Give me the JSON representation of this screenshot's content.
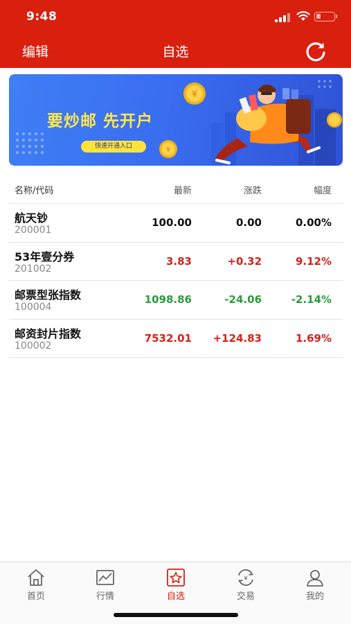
{
  "status_bar": {
    "time": "9:48",
    "battery_percent": 25
  },
  "nav": {
    "left_label": "编辑",
    "title": "自选",
    "right_icon": "refresh-icon"
  },
  "banner": {
    "headline": "要炒邮 先开户",
    "button_label": "快速开通入口"
  },
  "table": {
    "headers": {
      "name": "名称/代码",
      "latest": "最新",
      "change": "涨跌",
      "pct": "幅度"
    },
    "rows": [
      {
        "name": "航天钞",
        "code": "200001",
        "latest": "100.00",
        "change": "0.00",
        "pct": "0.00%"
      },
      {
        "name": "53年壹分券",
        "code": "201002",
        "latest": "3.83",
        "change": "+0.32",
        "pct": "9.12%"
      },
      {
        "name": "邮票型张指数",
        "code": "100004",
        "latest": "1098.86",
        "change": "-24.06",
        "pct": "-2.14%"
      },
      {
        "name": "邮资封片指数",
        "code": "100002",
        "latest": "7532.01",
        "change": "+124.83",
        "pct": "1.69%"
      }
    ]
  },
  "tabs": [
    {
      "label": "首页",
      "icon": "home-icon"
    },
    {
      "label": "行情",
      "icon": "chart-icon"
    },
    {
      "label": "自选",
      "icon": "star-icon",
      "active": true
    },
    {
      "label": "交易",
      "icon": "exchange-icon"
    },
    {
      "label": "我的",
      "icon": "user-icon"
    }
  ],
  "colors": {
    "brand": "#d9200f",
    "up": "#d8201a",
    "down": "#2a9a3c",
    "banner_text": "#ffe84a"
  }
}
